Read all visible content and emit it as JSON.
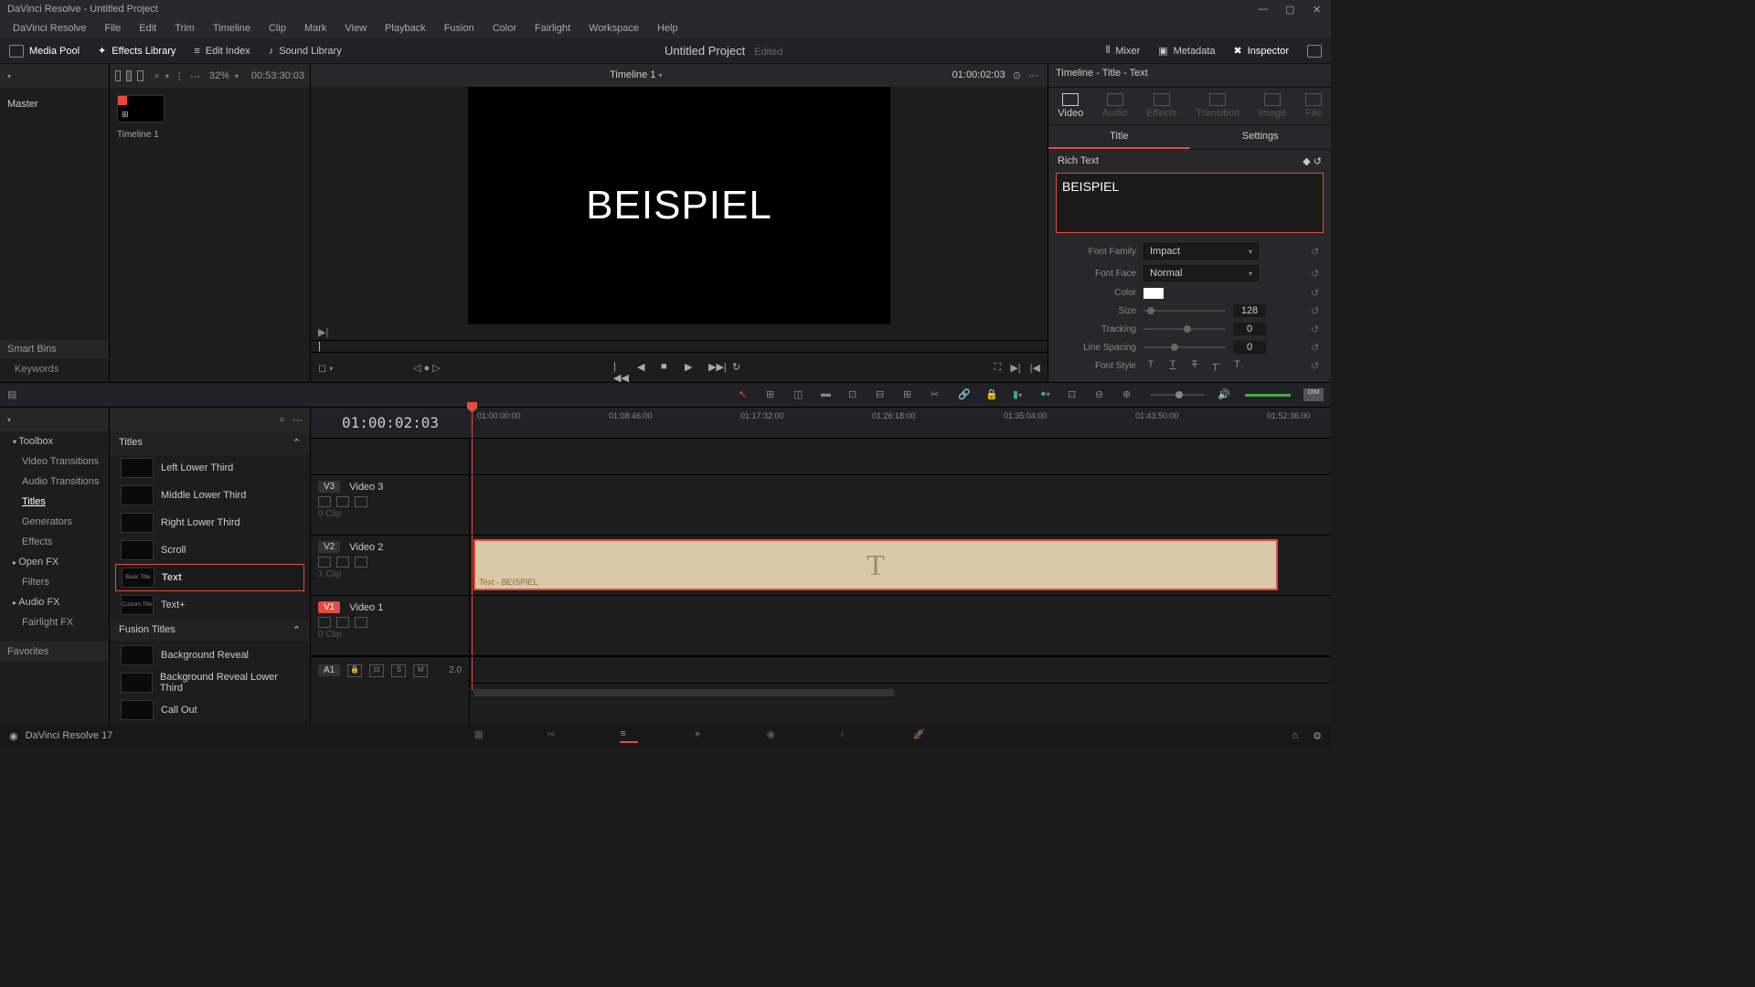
{
  "window": {
    "title": "DaVinci Resolve - Untitled Project"
  },
  "menu": [
    "DaVinci Resolve",
    "File",
    "Edit",
    "Trim",
    "Timeline",
    "Clip",
    "Mark",
    "View",
    "Playback",
    "Fusion",
    "Color",
    "Fairlight",
    "Workspace",
    "Help"
  ],
  "toolbar": {
    "media_pool": "Media Pool",
    "effects_library": "Effects Library",
    "edit_index": "Edit Index",
    "sound_library": "Sound Library",
    "project": "Untitled Project",
    "edited": "Edited",
    "mixer": "Mixer",
    "metadata": "Metadata",
    "inspector": "Inspector"
  },
  "mediapool": {
    "master": "Master",
    "smartbins": "Smart Bins",
    "keywords": "Keywords",
    "clip_label": "Timeline 1"
  },
  "viewer": {
    "zoom": "32%",
    "tc_left": "00:53:30:03",
    "name": "Timeline 1",
    "tc_right": "01:00:02:03",
    "preview_text": "BEISPIEL"
  },
  "inspector": {
    "title": "Timeline - Title - Text",
    "tabs": [
      "Video",
      "Audio",
      "Effects",
      "Transition",
      "Image",
      "File"
    ],
    "subtabs": [
      "Title",
      "Settings"
    ],
    "section": "Rich Text",
    "text_value": "BEISPIEL",
    "font_family_lbl": "Font Family",
    "font_family": "Impact",
    "font_face_lbl": "Font Face",
    "font_face": "Normal",
    "color_lbl": "Color",
    "size_lbl": "Size",
    "size": "128",
    "tracking_lbl": "Tracking",
    "tracking": "0",
    "line_spacing_lbl": "Line Spacing",
    "line_spacing": "0",
    "font_style_lbl": "Font Style"
  },
  "fx_sidebar": {
    "toolbox": "Toolbox",
    "items": [
      "Video Transitions",
      "Audio Transitions",
      "Titles",
      "Generators",
      "Effects"
    ],
    "open_fx": "Open FX",
    "filters": "Filters",
    "audio_fx": "Audio FX",
    "fairlight_fx": "Fairlight FX",
    "favorites": "Favorites"
  },
  "titles_pane": {
    "section1": "Titles",
    "items": [
      "Left Lower Third",
      "Middle Lower Third",
      "Right Lower Third",
      "Scroll",
      "Text",
      "Text+"
    ],
    "thumbs": [
      "",
      "",
      "",
      "",
      "Basic Title",
      "Custom Title"
    ],
    "section2": "Fusion Titles",
    "fusion_items": [
      "Background Reveal",
      "Background Reveal Lower Third",
      "Call Out"
    ]
  },
  "timeline": {
    "tc": "01:00:02:03",
    "ruler": [
      "01:00:00:00",
      "01:08:46:00",
      "01:17:32:00",
      "01:26:18:00",
      "01:35:04:00",
      "01:43:50:00",
      "01:52:36:00"
    ],
    "tracks": [
      {
        "id": "V3",
        "name": "Video 3",
        "clips": "0 Clip"
      },
      {
        "id": "V2",
        "name": "Video 2",
        "clips": "1 Clip"
      },
      {
        "id": "V1",
        "name": "Video 1",
        "clips": "0 Clip"
      }
    ],
    "audio": {
      "id": "A1",
      "rate": "2.0"
    },
    "clip_label": "Text - BEISPIEL"
  },
  "bottombar": {
    "version": "DaVinci Resolve 17"
  }
}
